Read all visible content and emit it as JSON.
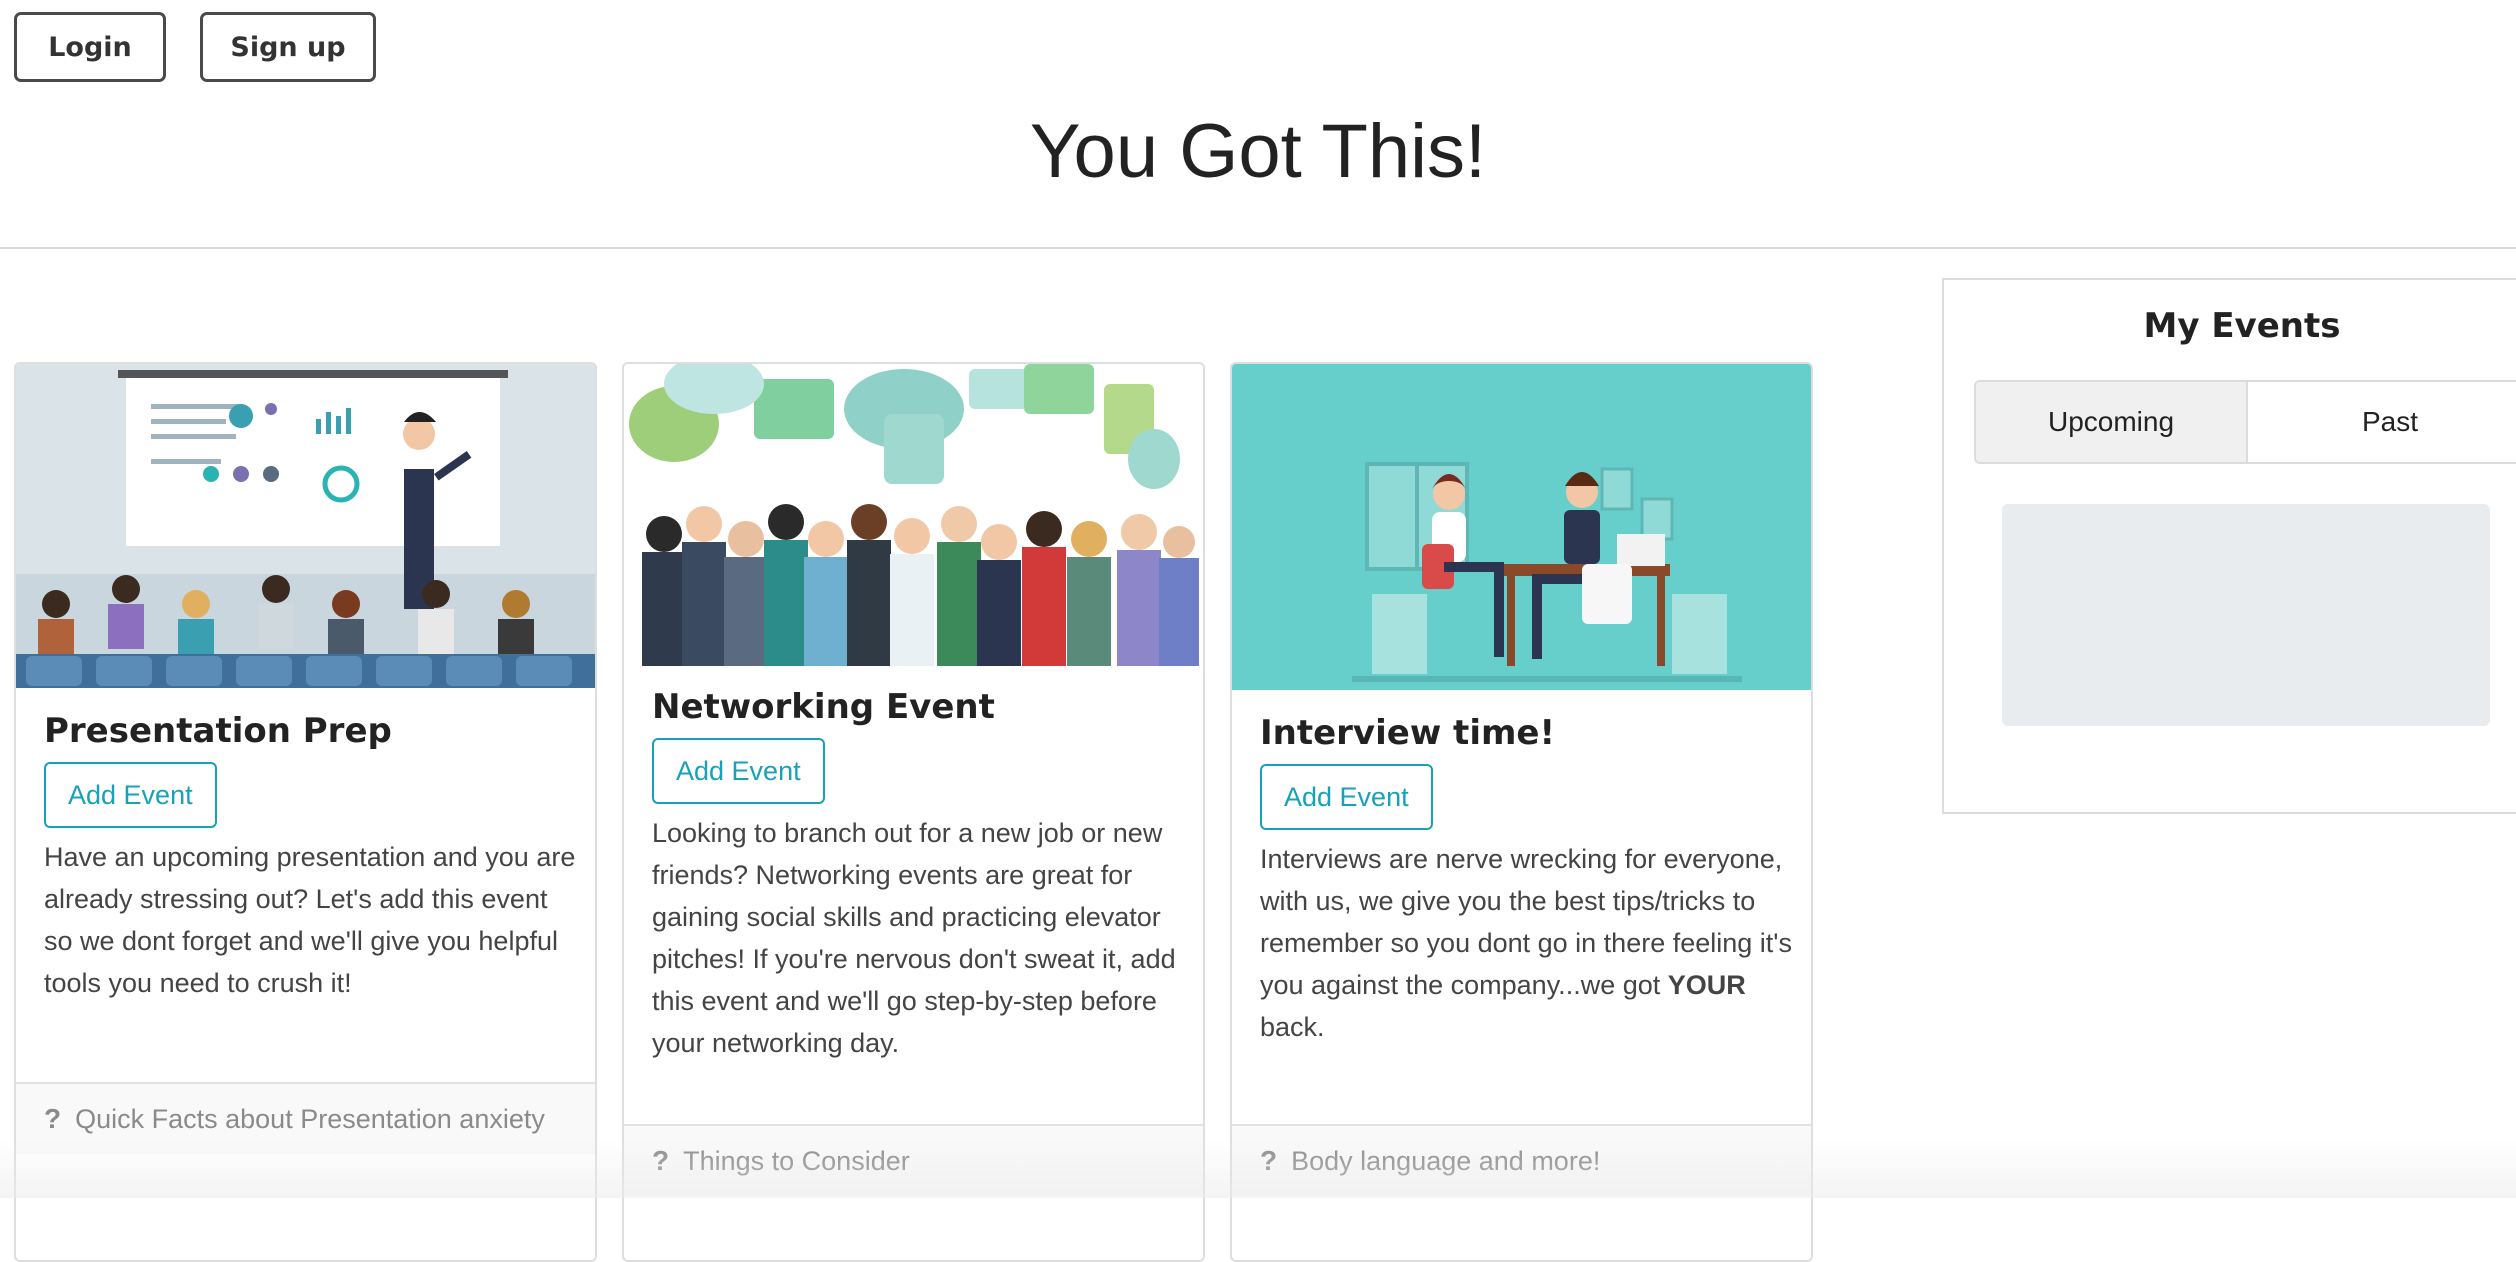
{
  "header": {
    "login_label": "Login",
    "signup_label": "Sign up",
    "title": "You Got This!"
  },
  "cards": [
    {
      "title": "Presentation Prep",
      "button": "Add Event",
      "text": "Have an upcoming presentation and you are already stressing out? Let's add this event so we dont forget and we'll give you helpful tools you need to crush it!",
      "footer_icon": "question-icon",
      "footer": "Quick Facts about Presentation anxiety"
    },
    {
      "title": "Networking Event",
      "button": "Add Event",
      "text": "Looking to branch out for a new job or new friends? Networking events are great for gaining social skills and practicing elevator pitches! If you're nervous don't sweat it, add this event and we'll go step-by-step before your networking day.",
      "footer_icon": "question-icon",
      "footer": "Things to Consider"
    },
    {
      "title": "Interview time!",
      "button": "Add Event",
      "text_before": "Interviews are nerve wrecking for everyone, with us, we give you the best tips/tricks to remember so you dont go in there feeling it's you against the company...we got ",
      "text_bold": "YOUR",
      "text_after": " back.",
      "footer_icon": "question-icon",
      "footer": "Body language and more!"
    }
  ],
  "my_events": {
    "title": "My Events",
    "tabs": [
      "Upcoming",
      "Past"
    ],
    "active_tab": "Upcoming"
  },
  "colors": {
    "accent": "#17a2b8",
    "interview_bg": "#66cfcc",
    "placeholder": "#e9ecef"
  }
}
